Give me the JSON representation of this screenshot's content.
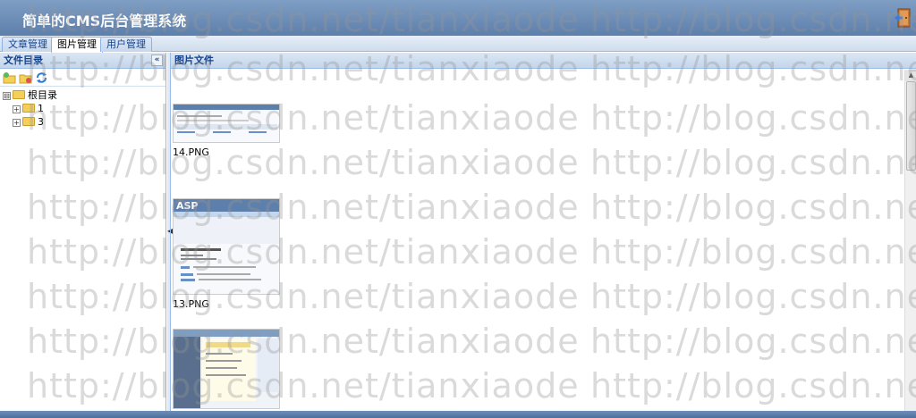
{
  "header": {
    "title": "简单的CMS后台管理系统",
    "exit_icon": "exit-door-icon"
  },
  "tabs": [
    {
      "label": "文章管理",
      "active": false
    },
    {
      "label": "图片管理",
      "active": true
    },
    {
      "label": "用户管理",
      "active": false
    }
  ],
  "left_panel": {
    "title": "文件目录",
    "collapse_icon": "«",
    "toolbar": [
      {
        "icon": "new-folder-icon"
      },
      {
        "icon": "delete-folder-icon"
      },
      {
        "icon": "refresh-icon"
      }
    ],
    "tree": {
      "root": {
        "label": "根目录",
        "expander": "⊟"
      },
      "children": [
        {
          "label": "1",
          "expander": "+"
        },
        {
          "label": "3",
          "expander": "+"
        }
      ]
    }
  },
  "right_panel": {
    "title": "图片文件",
    "images": [
      {
        "caption": "14.PNG"
      },
      {
        "caption": "13.PNG"
      },
      {
        "caption": ""
      }
    ]
  },
  "watermark": "http://blog.csdn.net/tianxiaode",
  "colors": {
    "header": "#5d7fab",
    "panel_header_text": "#15428b",
    "border": "#99bbe8"
  }
}
